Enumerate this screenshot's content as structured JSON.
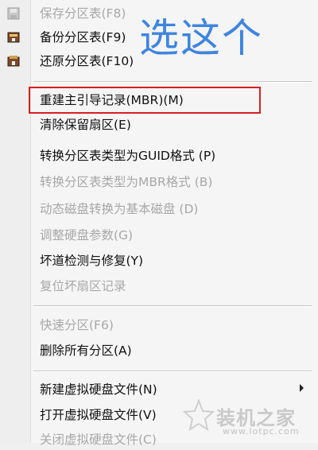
{
  "overlay_text": "选这个",
  "watermark": {
    "brand": "装机之家",
    "url": "www.lotpc.com"
  },
  "menu": {
    "items": [
      {
        "label": "保存分区表(F8)",
        "disabled": true,
        "icon": "save-icon"
      },
      {
        "label": "备份分区表(F9)",
        "disabled": false,
        "icon": "backup-icon"
      },
      {
        "label": "还原分区表(F10)",
        "disabled": false,
        "icon": "restore-icon"
      },
      {
        "label": "重建主引导记录(MBR)(M)",
        "disabled": false
      },
      {
        "label": "清除保留扇区(E)",
        "disabled": false
      },
      {
        "label": "转换分区表类型为GUID格式 (P)",
        "disabled": false
      },
      {
        "label": "转换分区表类型为MBR格式 (B)",
        "disabled": true
      },
      {
        "label": "动态磁盘转换为基本磁盘 (D)",
        "disabled": true
      },
      {
        "label": "调整硬盘参数(G)",
        "disabled": true
      },
      {
        "label": "坏道检测与修复(Y)",
        "disabled": false
      },
      {
        "label": "复位坏扇区记录",
        "disabled": true
      },
      {
        "label": "快速分区(F6)",
        "disabled": true
      },
      {
        "label": "删除所有分区(A)",
        "disabled": false
      },
      {
        "label": "新建虚拟硬盘文件(N)",
        "disabled": false,
        "submenu": true
      },
      {
        "label": "打开虚拟硬盘文件(V)",
        "disabled": false
      },
      {
        "label": "关闭虚拟硬盘文件(C)",
        "disabled": true
      }
    ]
  },
  "colors": {
    "highlight_border": "#d42020",
    "overlay_text": "#3f85de"
  }
}
